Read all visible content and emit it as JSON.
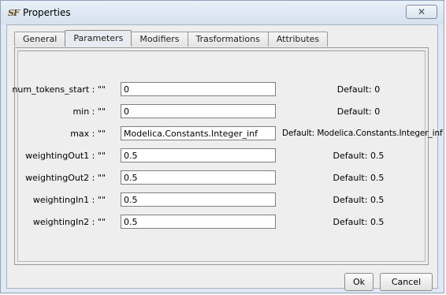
{
  "window": {
    "icon_text": "SF",
    "title": "Properties",
    "close_label": "✕"
  },
  "tabs": [
    {
      "label": "General",
      "active": false
    },
    {
      "label": "Parameters",
      "active": true
    },
    {
      "label": "Modifiers",
      "active": false
    },
    {
      "label": "Trasformations",
      "active": false
    },
    {
      "label": "Attributes",
      "active": false
    }
  ],
  "parameters": [
    {
      "label": "num_tokens_start : \"\"",
      "value": "0",
      "default": "Default: 0"
    },
    {
      "label": "min : \"\"",
      "value": "0",
      "default": "Default: 0"
    },
    {
      "label": "max : \"\"",
      "value": "Modelica.Constants.Integer_inf",
      "default": "Default: Modelica.Constants.Integer_inf"
    },
    {
      "label": "weightingOut1 : \"\"",
      "value": "0.5",
      "default": "Default: 0.5"
    },
    {
      "label": "weightingOut2 : \"\"",
      "value": "0.5",
      "default": "Default: 0.5"
    },
    {
      "label": "weightingIn1 : \"\"",
      "value": "0.5",
      "default": "Default: 0.5"
    },
    {
      "label": "weightingIn2 : \"\"",
      "value": "0.5",
      "default": "Default: 0.5"
    }
  ],
  "buttons": {
    "ok": "Ok",
    "cancel": "Cancel"
  }
}
